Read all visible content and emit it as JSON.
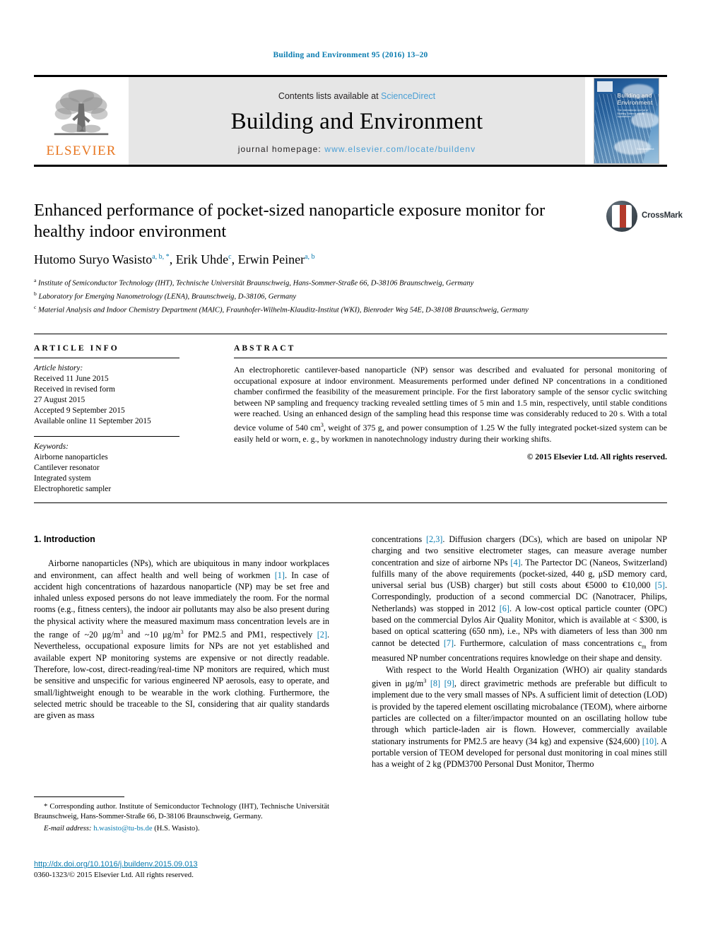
{
  "running_head": "Building and Environment 95 (2016) 13–20",
  "masthead": {
    "contents_prefix": "Contents lists available at ",
    "contents_link": "ScienceDirect",
    "journal_name": "Building and Environment",
    "homepage_label": "journal homepage: ",
    "homepage_url": "www.elsevier.com/locate/buildenv",
    "publisher_wordmark": "ELSEVIER",
    "cover": {
      "title_line1": "Building and",
      "title_line2": "Environment",
      "subtitle": "The International Journal of Building Science and its Applications",
      "editor": "Editor-in-Chief: Jan Sundell",
      "corner_text": "ScienceDirect"
    }
  },
  "article": {
    "title": "Enhanced performance of pocket-sized nanoparticle exposure monitor for healthy indoor environment",
    "crossmark_label": "CrossMark",
    "authors": [
      {
        "name": "Hutomo Suryo Wasisto",
        "marks": "a, b, *"
      },
      {
        "name": "Erik Uhde",
        "marks": "c"
      },
      {
        "name": "Erwin Peiner",
        "marks": "a, b"
      }
    ],
    "affiliations": [
      {
        "mark": "a",
        "text": "Institute of Semiconductor Technology (IHT), Technische Universität Braunschweig, Hans-Sommer-Straße 66, D-38106 Braunschweig, Germany"
      },
      {
        "mark": "b",
        "text": "Laboratory for Emerging Nanometrology (LENA), Braunschweig, D-38106, Germany"
      },
      {
        "mark": "c",
        "text": "Material Analysis and Indoor Chemistry Department (MAIC), Fraunhofer-Wilhelm-Klauditz-Institut (WKI), Bienroder Weg 54E, D-38108 Braunschweig, Germany"
      }
    ]
  },
  "article_info": {
    "heading": "ARTICLE INFO",
    "history_label": "Article history:",
    "history": [
      "Received 11 June 2015",
      "Received in revised form",
      "27 August 2015",
      "Accepted 9 September 2015",
      "Available online 11 September 2015"
    ],
    "keywords_label": "Keywords:",
    "keywords": [
      "Airborne nanoparticles",
      "Cantilever resonator",
      "Integrated system",
      "Electrophoretic sampler"
    ]
  },
  "abstract": {
    "heading": "ABSTRACT",
    "text_part1": "An electrophoretic cantilever-based nanoparticle (NP) sensor was described and evaluated for personal monitoring of occupational exposure at indoor environment. Measurements performed under defined NP concentrations in a conditioned chamber confirmed the feasibility of the measurement principle. For the first laboratory sample of the sensor cyclic switching between NP sampling and frequency tracking revealed settling times of 5 min and 1.5 min, respectively, until stable conditions were reached. Using an enhanced design of the sampling head this response time was considerably reduced to 20 s. With a total device volume of 540 cm",
    "sup1": "3",
    "text_part2": ", weight of 375 g, and power consumption of 1.25 W the fully integrated pocket-sized system can be easily held or worn, e. g., by workmen in nanotechnology industry during their working shifts.",
    "copyright": "© 2015 Elsevier Ltd. All rights reserved."
  },
  "introduction": {
    "section_number_title": "1. Introduction",
    "left_p1_a": "Airborne nanoparticles (NPs), which are ubiquitous in many indoor workplaces and environment, can affect health and well being of workmen ",
    "left_p1_ref1": "[1]",
    "left_p1_b": ". In case of accident high concentrations of hazardous nanoparticle (NP) may be set free and inhaled unless exposed persons do not leave immediately the room. For the normal rooms (e.g., fitness centers), the indoor air pollutants may also be also present during the physical activity where the measured maximum mass concentration levels are in the range of ~20 μg/m",
    "left_p1_sup1": "3",
    "left_p1_c": " and ~10 μg/m",
    "left_p1_sup2": "3",
    "left_p1_d": " for PM2.5 and PM1, respectively ",
    "left_p1_ref2": "[2]",
    "left_p1_e": ". Nevertheless, occupational exposure limits for NPs are not yet established and available expert NP monitoring systems are expensive or not directly readable. Therefore, low-cost, direct-reading/real-time NP monitors are required, which must be sensitive and unspecific for various engineered NP aerosols, easy to operate, and small/lightweight enough to be wearable in the work clothing. Furthermore, the selected metric should be traceable to the SI, considering that air quality standards are given as mass",
    "right_p1_a": "concentrations ",
    "right_p1_ref1": "[2,3]",
    "right_p1_b": ". Diffusion chargers (DCs), which are based on unipolar NP charging and two sensitive electrometer stages, can measure average number concentration and size of airborne NPs ",
    "right_p1_ref2": "[4]",
    "right_p1_c": ". The Partector DC (Naneos, Switzerland) fulfills many of the above requirements (pocket-sized, 440 g, μSD memory card, universal serial bus (USB) charger) but still costs about €5000 to €10,000 ",
    "right_p1_ref3": "[5]",
    "right_p1_d": ". Correspondingly, production of a second commercial DC (Nanotracer, Philips, Netherlands) was stopped in 2012 ",
    "right_p1_ref4": "[6]",
    "right_p1_e": ". A low-cost optical particle counter (OPC) based on the commercial Dylos Air Quality Monitor, which is available at < $300, is based on optical scattering (650 nm), i.e., NPs with diameters of less than 300 nm cannot be detected ",
    "right_p1_ref5": "[7]",
    "right_p1_f": ". Furthermore, calculation of mass concentrations c",
    "right_p1_sub1": "m",
    "right_p1_g": " from measured NP number concentrations requires knowledge on their shape and density.",
    "right_p2_a": "With respect to the World Health Organization (WHO) air quality standards given in μg/m",
    "right_p2_sup1": "3",
    "right_p2_b": " ",
    "right_p2_ref1": "[8]",
    "right_p2_c": " ",
    "right_p2_ref2": "[9]",
    "right_p2_d": ", direct gravimetric methods are preferable but difficult to implement due to the very small masses of NPs. A sufficient limit of detection (LOD) is provided by the tapered element oscillating microbalance (TEOM), where airborne particles are collected on a filter/impactor mounted on an oscillating hollow tube through which particle-laden air is flown. However, commercially available stationary instruments for PM2.5 are heavy (34 kg) and expensive ($24,600) ",
    "right_p2_ref3": "[10]",
    "right_p2_e": ". A portable version of TEOM developed for personal dust monitoring in coal mines still has a weight of 2 kg (PDM3700 Personal Dust Monitor, Thermo"
  },
  "footnote": {
    "corresponding": "* Corresponding author. Institute of Semiconductor Technology (IHT), Technische Universität Braunschweig, Hans-Sommer-Straße 66, D-38106 Braunschweig, Germany.",
    "email_label": "E-mail address:",
    "email": "h.wasisto@tu-bs.de",
    "email_owner": "(H.S. Wasisto)."
  },
  "footer": {
    "doi_url": "http://dx.doi.org/10.1016/j.buildenv.2015.09.013",
    "issn_line": "0360-1323/© 2015 Elsevier Ltd. All rights reserved."
  },
  "colors": {
    "link_blue": "#0b7cb0",
    "elsevier_orange": "#E87722",
    "masthead_grey": "#e6e6e6"
  }
}
